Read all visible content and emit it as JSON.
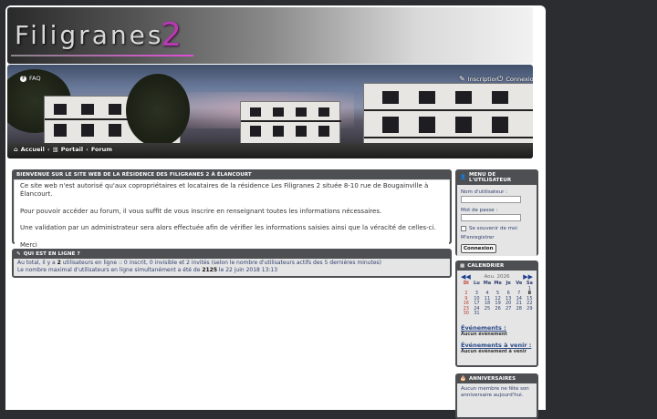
{
  "header": {
    "logo_text": "Filigranes",
    "logo_number": "2"
  },
  "topnav": {
    "faq": "FAQ",
    "register": "Inscription",
    "login": "Connexion"
  },
  "breadcrumb": {
    "home": "Accueil",
    "portal": "Portail",
    "forum": "Forum",
    "separator": "‹"
  },
  "welcome": {
    "title": "BIENVENUE SUR LE SITE WEB DE LA RÉSIDENCE DES FILIGRANES 2 À ÉLANCOURT",
    "p1": "Ce site web n'est autorisé qu'aux copropriétaires et locataires de la résidence Les Filigranes 2 située 8-10 rue de Bougainville à Élancourt.",
    "p2": "Pour pouvoir accéder au forum, il vous suffit de vous inscrire en renseignant toutes les informations nécessaires.",
    "p3": "Une validation par un administrateur sera alors effectuée afin de vérifier les informations saisies ainsi que la véracité de celles-ci.",
    "p4": "Merci"
  },
  "online": {
    "title": "QUI EST EN LIGNE ?",
    "line1_a": "Au total, il y a ",
    "line1_count": "2",
    "line1_b": " utilisateurs en ligne :: 0 inscrit, 0 invisible et 2 invités (selon le nombre d'utilisateurs actifs des 5 dernières minutes)",
    "line2_a": "Le nombre maximal d'utilisateurs en ligne simultanément a été de ",
    "line2_count": "2125",
    "line2_b": " le 22 juin 2018 13:13"
  },
  "user_menu": {
    "title": "MENU DE L'UTILISATEUR",
    "username_label": "Nom d'utilisateur :",
    "password_label": "Mot de passe :",
    "remember_label": "Se souvenir de moi",
    "register_link": "M'enregistrer",
    "login_button": "Connexion"
  },
  "calendar": {
    "title": "CALENDRIER",
    "month": "Aou. 2026",
    "prev": "◀◀",
    "next": "▶▶",
    "days": [
      "Di",
      "Lu",
      "Ma",
      "Me",
      "Je",
      "Ve",
      "Sa"
    ],
    "weeks": [
      [
        "",
        "",
        "",
        "",
        "",
        "",
        "1"
      ],
      [
        "2",
        "3",
        "4",
        "5",
        "6",
        "7",
        "8"
      ],
      [
        "9",
        "10",
        "11",
        "12",
        "13",
        "14",
        "15"
      ],
      [
        "16",
        "17",
        "18",
        "19",
        "20",
        "21",
        "22"
      ],
      [
        "23",
        "24",
        "25",
        "26",
        "27",
        "28",
        "29"
      ],
      [
        "30",
        "31",
        "",
        "",
        "",
        "",
        ""
      ]
    ],
    "today": "8",
    "events_title": "Événements :",
    "events_none": "Aucun événement",
    "upcoming_title": "Événements à venir :",
    "upcoming_none": "Aucun événement à venir"
  },
  "anniversaries": {
    "title": "ANNIVERSAIRES",
    "text": "Aucun membre ne fête son anniversaire aujourd'hui."
  },
  "colors": {
    "panel_border": "#4d4f52",
    "accent": "#b53bb0",
    "link": "#304070"
  },
  "icons": [
    "help-icon",
    "edit-icon",
    "power-icon",
    "home-icon",
    "portal-icon",
    "user-icon",
    "calendar-icon",
    "cake-icon",
    "chat-icon"
  ]
}
